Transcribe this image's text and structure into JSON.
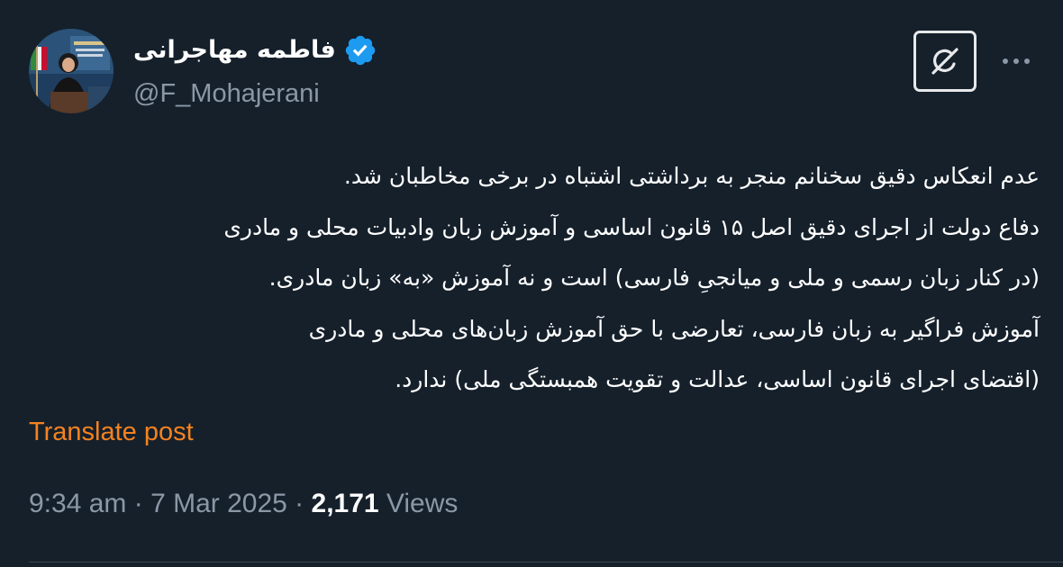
{
  "author": {
    "display_name": "فاطمه مهاجرانی",
    "handle": "@F_Mohajerani",
    "verified": true
  },
  "post": {
    "lines": [
      "عدم انعکاس دقیق سخنانم منجر به برداشتی اشتباه در برخی مخاطبان شد.",
      "دفاع دولت از اجرای دقیق اصل ۱۵ قانون اساسی و آموزش زبان وادبیات محلی و مادری",
      "(در کنار زبان رسمی و ملی و میانجیِ فارسی) است و نه آموزش «به» زبان مادری.",
      "آموزش فراگیر به زبان فارسی، تعارضی با حق آموزش زبان‌های محلی و مادری",
      "(اقتضای اجرای قانون اساسی، عدالت و تقویت همبستگی ملی) ندارد."
    ]
  },
  "actions": {
    "translate_label": "Translate post",
    "grok_icon": "grok-icon",
    "more_icon": "more-icon"
  },
  "meta": {
    "time": "9:34 am",
    "separator": " · ",
    "date": "7 Mar 2025",
    "views_count": "2,171",
    "views_label": " Views"
  },
  "colors": {
    "background": "#15202b",
    "text": "#ffffff",
    "secondary_text": "#8b98a5",
    "translate_link": "#f5821f",
    "verified_badge": "#1d9bf0"
  }
}
